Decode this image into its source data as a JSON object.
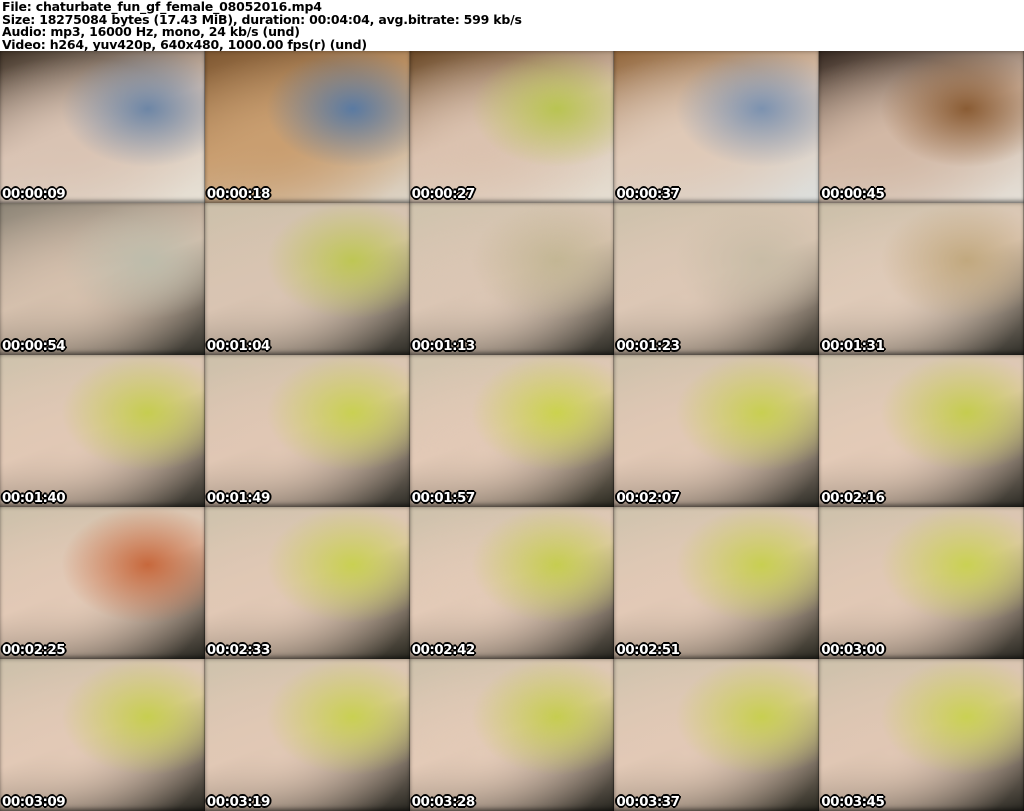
{
  "header": {
    "lines": [
      "File: chaturbate_fun_gf_female_08052016.mp4",
      "Size: 18275084 bytes (17.43 MiB), duration: 00:04:04, avg.bitrate: 599 kb/s",
      "Audio: mp3, 16000 Hz, mono, 24 kb/s (und)",
      "Video: h264, yuv420p, 640x480, 1000.00 fps(r) (und)"
    ],
    "text_color": "#000000",
    "background_color": "#ffffff"
  },
  "grid": {
    "columns": 5,
    "rows": 5,
    "thumbnails": [
      {
        "timestamp": "00:00:09",
        "colors": [
          "#3f3226",
          "#d9c3b3",
          "#e7e2d7",
          "#6d86a6"
        ]
      },
      {
        "timestamp": "00:00:18",
        "colors": [
          "#7d5630",
          "#c99e70",
          "#ddd6ca",
          "#5a7aa2"
        ]
      },
      {
        "timestamp": "00:00:27",
        "colors": [
          "#6a4826",
          "#dbc2af",
          "#e5dfd3",
          "#b9c452"
        ]
      },
      {
        "timestamp": "00:00:37",
        "colors": [
          "#91653a",
          "#dfc9b7",
          "#dde0de",
          "#7c92b0"
        ]
      },
      {
        "timestamp": "00:00:45",
        "colors": [
          "#352820",
          "#d2b8a5",
          "#e5e1d9",
          "#8a5c34"
        ]
      },
      {
        "timestamp": "00:00:54",
        "colors": [
          "#8c8476",
          "#d5c0ad",
          "#2f2e28",
          "#bdbcab"
        ]
      },
      {
        "timestamp": "00:01:04",
        "colors": [
          "#ccc0aa",
          "#d9c4b2",
          "#2c2b25",
          "#bec654"
        ]
      },
      {
        "timestamp": "00:01:13",
        "colors": [
          "#cfc3ad",
          "#dbc6b4",
          "#2a2923",
          "#c3b694"
        ]
      },
      {
        "timestamp": "00:01:23",
        "colors": [
          "#cdc1ab",
          "#dcc7b5",
          "#333028",
          "#c8bca6"
        ]
      },
      {
        "timestamp": "00:01:31",
        "colors": [
          "#cbbfa9",
          "#dfcab8",
          "#2e2d27",
          "#c1a87e"
        ]
      },
      {
        "timestamp": "00:01:40",
        "colors": [
          "#cec2ac",
          "#e1c8b5",
          "#2b2a24",
          "#c6cd50"
        ]
      },
      {
        "timestamp": "00:01:49",
        "colors": [
          "#ccc0aa",
          "#e0c7b4",
          "#2c2b25",
          "#c9d052"
        ]
      },
      {
        "timestamp": "00:01:57",
        "colors": [
          "#cfc3ad",
          "#e2c9b6",
          "#29281f",
          "#cbd24e"
        ]
      },
      {
        "timestamp": "00:02:07",
        "colors": [
          "#cdc1ab",
          "#e1c8b5",
          "#2b2a24",
          "#c8cf51"
        ]
      },
      {
        "timestamp": "00:02:16",
        "colors": [
          "#d0c4ae",
          "#e3cab7",
          "#2a2923",
          "#c5cc4f"
        ]
      },
      {
        "timestamp": "00:02:25",
        "colors": [
          "#ccc0aa",
          "#e2c9b6",
          "#26251f",
          "#c7683c"
        ]
      },
      {
        "timestamp": "00:02:33",
        "colors": [
          "#cec2ac",
          "#e1c8b5",
          "#27261e",
          "#c9d052"
        ]
      },
      {
        "timestamp": "00:02:42",
        "colors": [
          "#cdc1ab",
          "#e3cab7",
          "#26251f",
          "#c6cd50"
        ]
      },
      {
        "timestamp": "00:02:51",
        "colors": [
          "#cfc3ad",
          "#e2c9b6",
          "#28271f",
          "#c8cf51"
        ]
      },
      {
        "timestamp": "00:03:00",
        "colors": [
          "#cdc1ab",
          "#e1c8b5",
          "#26251f",
          "#cad153"
        ]
      },
      {
        "timestamp": "00:03:09",
        "colors": [
          "#ccc0aa",
          "#e2c9b6",
          "#25241e",
          "#c7ce50"
        ]
      },
      {
        "timestamp": "00:03:19",
        "colors": [
          "#cec2ac",
          "#e1c8b5",
          "#26251f",
          "#c9d052"
        ]
      },
      {
        "timestamp": "00:03:28",
        "colors": [
          "#cdc1ab",
          "#e3cab7",
          "#25241e",
          "#c6cd50"
        ]
      },
      {
        "timestamp": "00:03:37",
        "colors": [
          "#cfc3ad",
          "#e2c9b6",
          "#27261e",
          "#c8cf51"
        ]
      },
      {
        "timestamp": "00:03:45",
        "colors": [
          "#cdc1ab",
          "#e0c7b4",
          "#26251f",
          "#cad153"
        ]
      }
    ],
    "timestamp_text_color": "#ffffff",
    "timestamp_outline_color": "#000000"
  }
}
